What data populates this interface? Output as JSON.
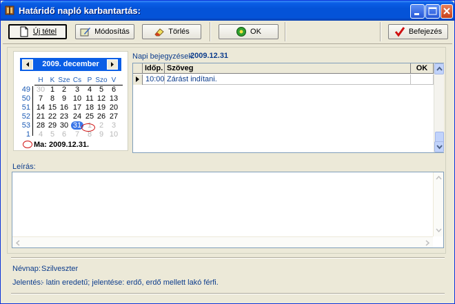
{
  "window": {
    "title": "Határidő napló karbantartás:"
  },
  "toolbar": {
    "new_label": "Új tétel",
    "edit_label": "Módosítás",
    "delete_label": "Törlés",
    "ok_label": "OK",
    "finish_label": "Befejezés"
  },
  "calendar": {
    "month_label": "2009. december",
    "dow": [
      "H",
      "K",
      "Sze",
      "Cs",
      "P",
      "Szo",
      "V"
    ],
    "weeks": [
      "49",
      "50",
      "51",
      "52",
      "53",
      "1"
    ],
    "days": [
      [
        "30",
        "1",
        "2",
        "3",
        "4",
        "5",
        "6"
      ],
      [
        "7",
        "8",
        "9",
        "10",
        "11",
        "12",
        "13"
      ],
      [
        "14",
        "15",
        "16",
        "17",
        "18",
        "19",
        "20"
      ],
      [
        "21",
        "22",
        "23",
        "24",
        "25",
        "26",
        "27"
      ],
      [
        "28",
        "29",
        "30",
        "31",
        "1",
        "2",
        "3"
      ],
      [
        "4",
        "5",
        "6",
        "7",
        "8",
        "9",
        "10"
      ]
    ],
    "today_label": "Ma: 2009.12.31."
  },
  "entries": {
    "label": "Napi bejegyzések:",
    "date": "2009.12.31",
    "columns": [
      "Időp.",
      "Szöveg",
      "OK"
    ],
    "rows": [
      {
        "time": "10:00",
        "text": "Zárást indítani.",
        "ok": ""
      }
    ]
  },
  "description": {
    "label": "Leírás:",
    "value": ""
  },
  "info": {
    "nameday_label": "Névnap:",
    "nameday_value": "Szilveszter",
    "meaning_label": "Jelentés:",
    "meaning_value": "- latin eredetű; jelentése: erdő, erdő mellett lakó férfi."
  },
  "colors": {
    "titlebar": "#0453d8",
    "accent": "#0a5ee6",
    "text_blue": "#0c3c8c",
    "today_ring": "#d01010"
  }
}
